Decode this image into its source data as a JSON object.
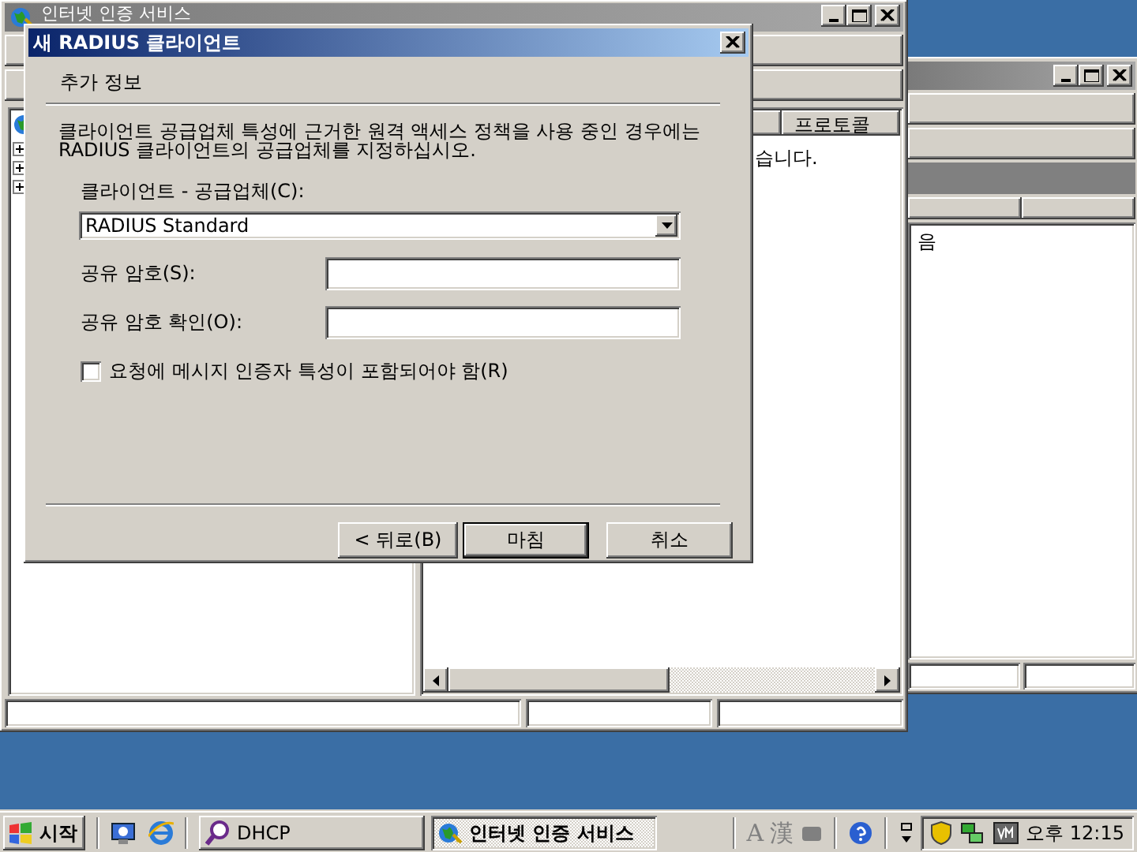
{
  "back_window": {
    "active": false,
    "list_text": "음"
  },
  "main_window": {
    "title": "인터넷 인증 서비스",
    "active": false,
    "columns": [
      {
        "label": "프로토콜"
      }
    ],
    "row_text": "습니다."
  },
  "dialog": {
    "title": "새 RADIUS 클라이언트",
    "active": true,
    "section": "추가 정보",
    "description": "클라이언트 공급업체 특성에 근거한 원격 액세스 정책을 사용 중인 경우에는\nRADIUS 클라이언트의 공급업체를 지정하십시오.",
    "vendor_label": "클라이언트 - 공급업체(C):",
    "vendor_value": "RADIUS Standard",
    "secret_label": "공유 암호(S):",
    "confirm_label": "공유 암호 확인(O):",
    "checkbox": {
      "label": "요청에 메시지 인증자 특성이 포함되어야 함(R)",
      "checked": false
    },
    "buttons": [
      {
        "label": "< 뒤로(B)",
        "default": false
      },
      {
        "label": "마침",
        "default": true
      },
      {
        "label": "취소",
        "default": false
      }
    ]
  },
  "taskbar": {
    "start": "시작",
    "tasks": [
      {
        "label": "DHCP",
        "selected": false
      },
      {
        "label": "인터넷 인증 서비스",
        "selected": true
      }
    ],
    "language_glyphs": [
      "A",
      "漢"
    ],
    "clock": "오후 12:15"
  }
}
